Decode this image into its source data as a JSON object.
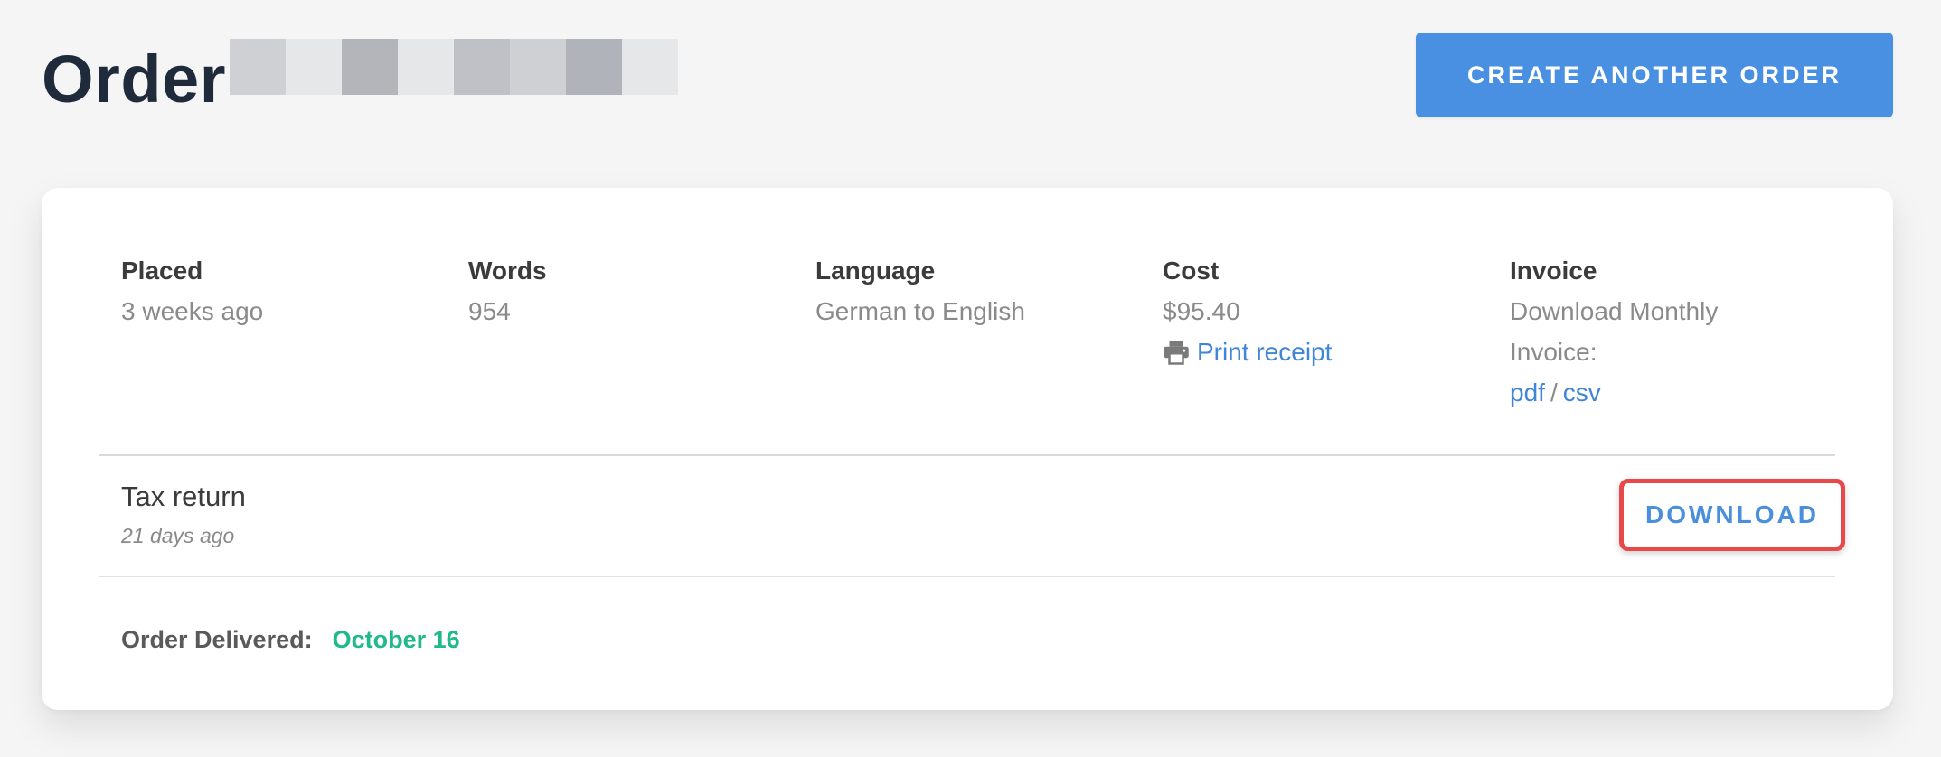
{
  "header": {
    "title": "Order",
    "create_button_label": "CREATE ANOTHER ORDER",
    "redacted_blocks": [
      "#cfd0d4",
      "#e6e7e9",
      "#b3b5bb",
      "#e6e7e9",
      "#bfc1c6",
      "#cfd0d4",
      "#b1b3ba",
      "#e6e7e9"
    ]
  },
  "order_meta": {
    "placed": {
      "label": "Placed",
      "value": "3 weeks ago"
    },
    "words": {
      "label": "Words",
      "value": "954"
    },
    "language": {
      "label": "Language",
      "value": "German to English"
    },
    "cost": {
      "label": "Cost",
      "value": "$95.40",
      "receipt_link": "Print receipt",
      "receipt_icon": "printer-icon"
    },
    "invoice": {
      "label": "Invoice",
      "line1": "Download Monthly",
      "line2": "Invoice:",
      "pdf_link": "pdf",
      "separator": "/",
      "csv_link": "csv"
    }
  },
  "file": {
    "name": "Tax return",
    "date": "21 days ago",
    "download_label": "DOWNLOAD"
  },
  "delivery": {
    "label": "Order Delivered:",
    "date": "October 16"
  },
  "colors": {
    "accent": "#4a90e2",
    "success": "#1fb98a",
    "highlight": "#e8484a"
  }
}
